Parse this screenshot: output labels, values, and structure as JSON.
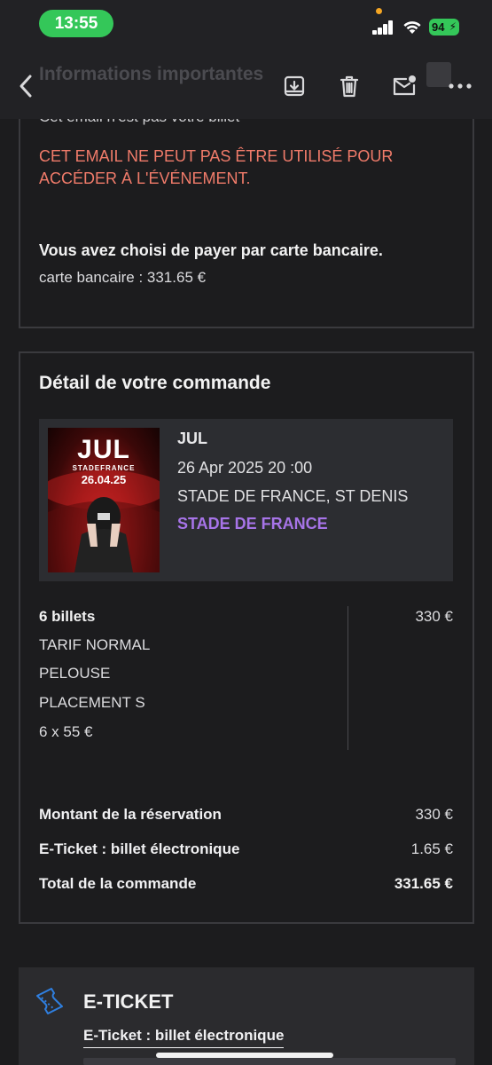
{
  "status_bar": {
    "time": "13:55",
    "battery": "94"
  },
  "toolbar": {
    "ghost_title": "Informations importantes",
    "back_icon": "chevron-left-icon",
    "archive_icon": "archive-icon",
    "delete_icon": "trash-icon",
    "mark_icon": "mail-unread-icon",
    "more_icon": "more-horizontal-icon"
  },
  "notice": {
    "cut_line": "Cet email n'est pas votre billet",
    "warning": "CET EMAIL NE PEUT PAS ÊTRE UTILISÉ POUR ACCÉDER À L'ÉVÉNEMENT.",
    "payment_title": "Vous avez choisi de payer par carte bancaire.",
    "payment_line": "carte bancaire : 331.65 €"
  },
  "order": {
    "title": "Détail de votre commande",
    "poster": {
      "logo": "JUL",
      "venue": "STADEFRANCE",
      "date": "26.04.25"
    },
    "event_name": "JUL",
    "event_datetime": "26 Apr 2025 20 :00",
    "event_place": "STADE DE FRANCE, ST DENIS",
    "event_venue_link": "STADE DE FRANCE",
    "tickets": {
      "count": "6 billets",
      "lines": [
        "TARIF NORMAL",
        "PELOUSE",
        "PLACEMENT S",
        "6 x 55 €"
      ],
      "price": "330 €"
    },
    "summary": [
      {
        "label": "Montant de la réservation",
        "value": "330 €"
      },
      {
        "label": "E-Ticket : billet électronique",
        "value": "1.65 €"
      },
      {
        "label": "Total de la commande",
        "value": "331.65 €"
      }
    ]
  },
  "eticket": {
    "title": "E-TICKET",
    "subtitle": "E-Ticket : billet électronique",
    "icon": "ticket-icon"
  },
  "colors": {
    "background": "#1c1c1e",
    "warning": "#f07b6a",
    "link": "#a774e8",
    "time_pill": "#34c759",
    "eticket_icon": "#2f7fe0"
  }
}
